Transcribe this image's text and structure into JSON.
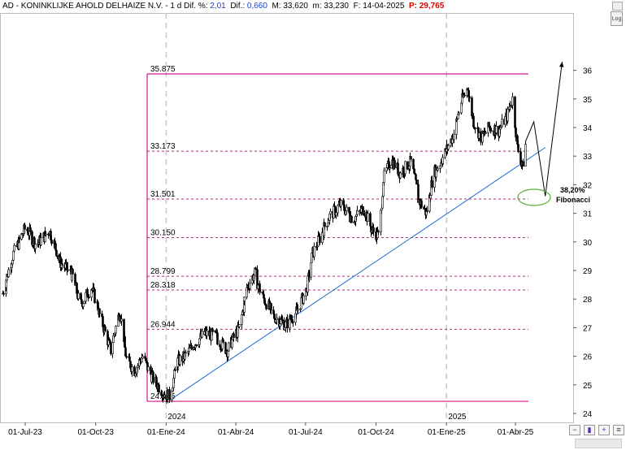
{
  "header": {
    "ticker": "AD - KONINKLIJKE AHOLD DELHAIZE N.V. - 1 d",
    "dif_pct_label": "Dif. %:",
    "dif_pct_value": "2,01",
    "dif_label": "Dif.:",
    "dif_value": "0,660",
    "max_label": "M:",
    "max_value": "33,620",
    "min_label": "m:",
    "min_value": "33,230",
    "date_label": "F:",
    "date_value": "14-04-2025",
    "price_label": "P:",
    "price_value": "29,765"
  },
  "controls": {
    "log_label": "Log",
    "zoom_out_icon": "zoom-out-icon",
    "cursor_icon": "cursor-icon",
    "zoom_in_icon": "zoom-in-icon",
    "settings_icon": "settings-icon"
  },
  "colors": {
    "fib": "#d4148c",
    "trend": "#1a6fd0",
    "candle": "#000000",
    "ellipse": "#5aae3e"
  },
  "chart_data": {
    "type": "candlestick",
    "ylim": [
      24,
      36.5
    ],
    "y_ticks": [
      "24",
      "25",
      "26",
      "27",
      "28",
      "29",
      "30",
      "31",
      "32",
      "33",
      "34",
      "35",
      "36"
    ],
    "x_ticks": [
      "01-Jul-23",
      "01-Oct-23",
      "01-Ene-24",
      "01-Abr-24",
      "01-Jul-24",
      "01-Oct-24",
      "01-Ene-25",
      "01-Abr-25"
    ],
    "year_labels": [
      "2024",
      "2025"
    ],
    "fibonacci_levels": [
      "35.875",
      "33.173",
      "31.501",
      "30.150",
      "28.799",
      "28.318",
      "26.944",
      "24.425"
    ],
    "fib_annotation_pct": "38,20%",
    "fib_annotation_text": "Fibonacci",
    "close_path": [
      [
        "2023-06-01",
        28.2
      ],
      [
        "2023-06-15",
        29.6
      ],
      [
        "2023-07-01",
        30.5
      ],
      [
        "2023-07-15",
        29.9
      ],
      [
        "2023-08-01",
        30.4
      ],
      [
        "2023-08-15",
        29.3
      ],
      [
        "2023-09-01",
        28.8
      ],
      [
        "2023-09-10",
        27.8
      ],
      [
        "2023-09-25",
        28.4
      ],
      [
        "2023-10-10",
        27.1
      ],
      [
        "2023-10-20",
        26.2
      ],
      [
        "2023-11-01",
        27.6
      ],
      [
        "2023-11-10",
        25.9
      ],
      [
        "2023-11-20",
        25.5
      ],
      [
        "2023-12-01",
        26.0
      ],
      [
        "2023-12-10",
        25.4
      ],
      [
        "2023-12-20",
        25.0
      ],
      [
        "2023-12-28",
        24.7
      ],
      [
        "2024-01-05",
        24.6
      ],
      [
        "2024-01-15",
        25.8
      ],
      [
        "2024-01-25",
        26.0
      ],
      [
        "2024-02-05",
        26.4
      ],
      [
        "2024-02-20",
        26.8
      ],
      [
        "2024-03-05",
        26.7
      ],
      [
        "2024-03-20",
        26.2
      ],
      [
        "2024-04-05",
        27.0
      ],
      [
        "2024-04-15",
        28.4
      ],
      [
        "2024-04-25",
        28.9
      ],
      [
        "2024-05-05",
        28.1
      ],
      [
        "2024-05-20",
        27.4
      ],
      [
        "2024-06-05",
        27.1
      ],
      [
        "2024-06-20",
        27.6
      ],
      [
        "2024-07-01",
        28.3
      ],
      [
        "2024-07-10",
        29.6
      ],
      [
        "2024-07-20",
        30.2
      ],
      [
        "2024-08-01",
        30.9
      ],
      [
        "2024-08-15",
        31.3
      ],
      [
        "2024-09-01",
        30.8
      ],
      [
        "2024-09-15",
        31.2
      ],
      [
        "2024-09-25",
        30.4
      ],
      [
        "2024-10-05",
        30.2
      ],
      [
        "2024-10-10",
        32.2
      ],
      [
        "2024-10-20",
        32.9
      ],
      [
        "2024-11-01",
        32.4
      ],
      [
        "2024-11-15",
        32.8
      ],
      [
        "2024-11-25",
        31.5
      ],
      [
        "2024-12-05",
        31.0
      ],
      [
        "2024-12-15",
        32.4
      ],
      [
        "2024-12-28",
        33.0
      ],
      [
        "2025-01-10",
        33.8
      ],
      [
        "2025-01-20",
        34.9
      ],
      [
        "2025-01-28",
        35.4
      ],
      [
        "2025-02-05",
        34.2
      ],
      [
        "2025-02-15",
        33.6
      ],
      [
        "2025-02-25",
        34.0
      ],
      [
        "2025-03-10",
        33.9
      ],
      [
        "2025-03-20",
        34.4
      ],
      [
        "2025-03-28",
        35.0
      ],
      [
        "2025-04-03",
        33.3
      ],
      [
        "2025-04-10",
        32.6
      ],
      [
        "2025-04-14",
        33.4
      ]
    ],
    "trendline": [
      [
        "2024-01-05",
        24.45
      ],
      [
        "2025-05-10",
        33.3
      ]
    ],
    "projection": [
      [
        "2025-04-14",
        33.5
      ],
      [
        "2025-04-25",
        34.2
      ],
      [
        "2025-05-10",
        31.6
      ],
      [
        "2025-06-01",
        36.3
      ]
    ]
  }
}
